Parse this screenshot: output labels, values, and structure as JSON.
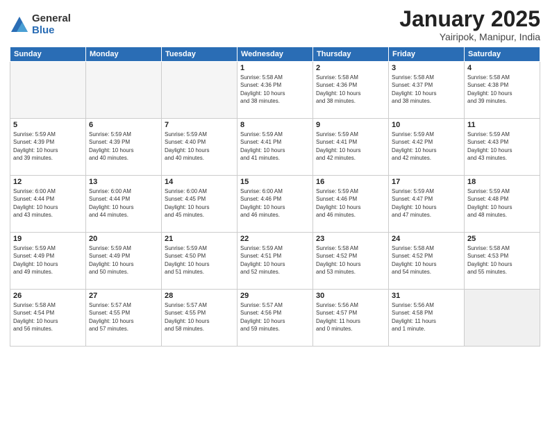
{
  "logo": {
    "general": "General",
    "blue": "Blue"
  },
  "title": "January 2025",
  "subtitle": "Yairipok, Manipur, India",
  "days_of_week": [
    "Sunday",
    "Monday",
    "Tuesday",
    "Wednesday",
    "Thursday",
    "Friday",
    "Saturday"
  ],
  "weeks": [
    [
      {
        "num": "",
        "info": "",
        "empty": true
      },
      {
        "num": "",
        "info": "",
        "empty": true
      },
      {
        "num": "",
        "info": "",
        "empty": true
      },
      {
        "num": "1",
        "info": "Sunrise: 5:58 AM\nSunset: 4:36 PM\nDaylight: 10 hours\nand 38 minutes."
      },
      {
        "num": "2",
        "info": "Sunrise: 5:58 AM\nSunset: 4:36 PM\nDaylight: 10 hours\nand 38 minutes."
      },
      {
        "num": "3",
        "info": "Sunrise: 5:58 AM\nSunset: 4:37 PM\nDaylight: 10 hours\nand 38 minutes."
      },
      {
        "num": "4",
        "info": "Sunrise: 5:58 AM\nSunset: 4:38 PM\nDaylight: 10 hours\nand 39 minutes."
      }
    ],
    [
      {
        "num": "5",
        "info": "Sunrise: 5:59 AM\nSunset: 4:39 PM\nDaylight: 10 hours\nand 39 minutes."
      },
      {
        "num": "6",
        "info": "Sunrise: 5:59 AM\nSunset: 4:39 PM\nDaylight: 10 hours\nand 40 minutes."
      },
      {
        "num": "7",
        "info": "Sunrise: 5:59 AM\nSunset: 4:40 PM\nDaylight: 10 hours\nand 40 minutes."
      },
      {
        "num": "8",
        "info": "Sunrise: 5:59 AM\nSunset: 4:41 PM\nDaylight: 10 hours\nand 41 minutes."
      },
      {
        "num": "9",
        "info": "Sunrise: 5:59 AM\nSunset: 4:41 PM\nDaylight: 10 hours\nand 42 minutes."
      },
      {
        "num": "10",
        "info": "Sunrise: 5:59 AM\nSunset: 4:42 PM\nDaylight: 10 hours\nand 42 minutes."
      },
      {
        "num": "11",
        "info": "Sunrise: 5:59 AM\nSunset: 4:43 PM\nDaylight: 10 hours\nand 43 minutes."
      }
    ],
    [
      {
        "num": "12",
        "info": "Sunrise: 6:00 AM\nSunset: 4:44 PM\nDaylight: 10 hours\nand 43 minutes."
      },
      {
        "num": "13",
        "info": "Sunrise: 6:00 AM\nSunset: 4:44 PM\nDaylight: 10 hours\nand 44 minutes."
      },
      {
        "num": "14",
        "info": "Sunrise: 6:00 AM\nSunset: 4:45 PM\nDaylight: 10 hours\nand 45 minutes."
      },
      {
        "num": "15",
        "info": "Sunrise: 6:00 AM\nSunset: 4:46 PM\nDaylight: 10 hours\nand 46 minutes."
      },
      {
        "num": "16",
        "info": "Sunrise: 5:59 AM\nSunset: 4:46 PM\nDaylight: 10 hours\nand 46 minutes."
      },
      {
        "num": "17",
        "info": "Sunrise: 5:59 AM\nSunset: 4:47 PM\nDaylight: 10 hours\nand 47 minutes."
      },
      {
        "num": "18",
        "info": "Sunrise: 5:59 AM\nSunset: 4:48 PM\nDaylight: 10 hours\nand 48 minutes."
      }
    ],
    [
      {
        "num": "19",
        "info": "Sunrise: 5:59 AM\nSunset: 4:49 PM\nDaylight: 10 hours\nand 49 minutes."
      },
      {
        "num": "20",
        "info": "Sunrise: 5:59 AM\nSunset: 4:49 PM\nDaylight: 10 hours\nand 50 minutes."
      },
      {
        "num": "21",
        "info": "Sunrise: 5:59 AM\nSunset: 4:50 PM\nDaylight: 10 hours\nand 51 minutes."
      },
      {
        "num": "22",
        "info": "Sunrise: 5:59 AM\nSunset: 4:51 PM\nDaylight: 10 hours\nand 52 minutes."
      },
      {
        "num": "23",
        "info": "Sunrise: 5:58 AM\nSunset: 4:52 PM\nDaylight: 10 hours\nand 53 minutes."
      },
      {
        "num": "24",
        "info": "Sunrise: 5:58 AM\nSunset: 4:52 PM\nDaylight: 10 hours\nand 54 minutes."
      },
      {
        "num": "25",
        "info": "Sunrise: 5:58 AM\nSunset: 4:53 PM\nDaylight: 10 hours\nand 55 minutes."
      }
    ],
    [
      {
        "num": "26",
        "info": "Sunrise: 5:58 AM\nSunset: 4:54 PM\nDaylight: 10 hours\nand 56 minutes."
      },
      {
        "num": "27",
        "info": "Sunrise: 5:57 AM\nSunset: 4:55 PM\nDaylight: 10 hours\nand 57 minutes."
      },
      {
        "num": "28",
        "info": "Sunrise: 5:57 AM\nSunset: 4:55 PM\nDaylight: 10 hours\nand 58 minutes."
      },
      {
        "num": "29",
        "info": "Sunrise: 5:57 AM\nSunset: 4:56 PM\nDaylight: 10 hours\nand 59 minutes."
      },
      {
        "num": "30",
        "info": "Sunrise: 5:56 AM\nSunset: 4:57 PM\nDaylight: 11 hours\nand 0 minutes."
      },
      {
        "num": "31",
        "info": "Sunrise: 5:56 AM\nSunset: 4:58 PM\nDaylight: 11 hours\nand 1 minute."
      },
      {
        "num": "",
        "info": "",
        "empty": true,
        "shaded": true
      }
    ]
  ]
}
